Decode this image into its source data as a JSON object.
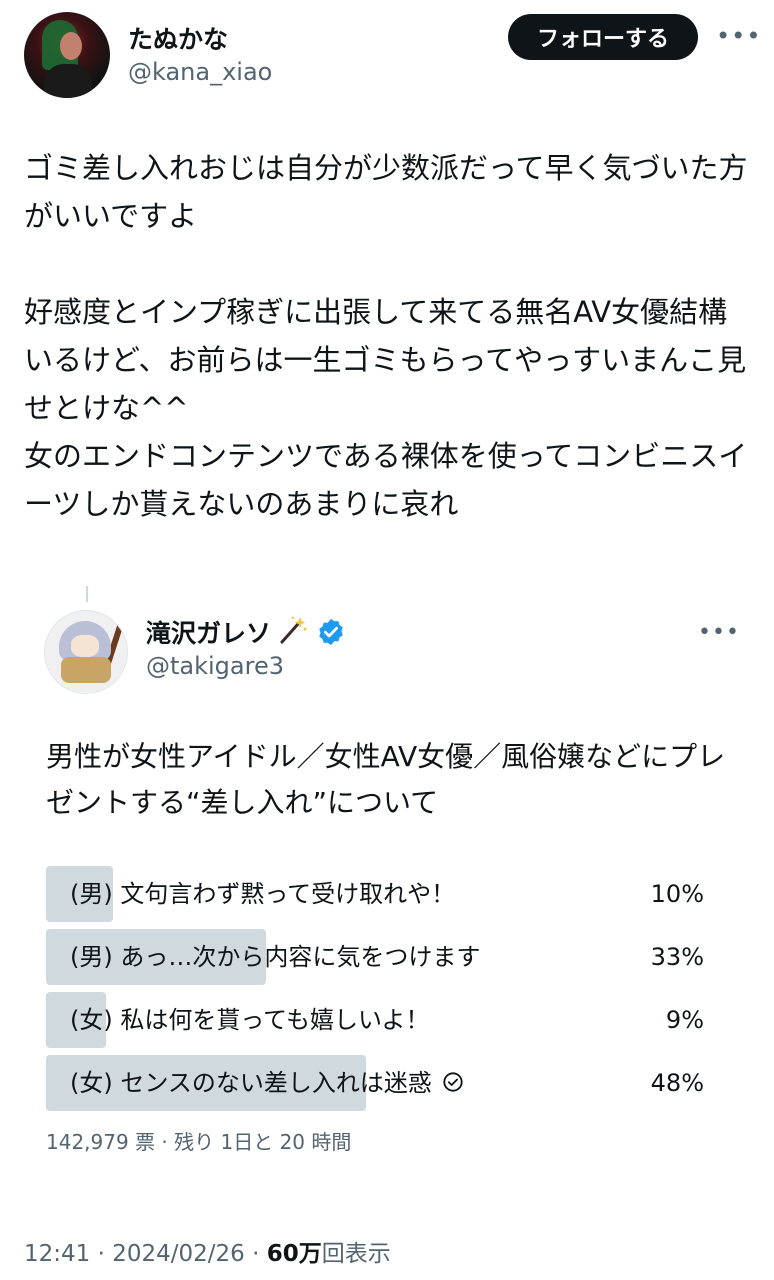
{
  "author": {
    "display_name": "たぬかな",
    "handle": "@kana_xiao"
  },
  "follow_button": "フォローする",
  "more_label": "•••",
  "tweet_text": "ゴミ差し入れおじは自分が少数派だって早く気づいた方がいいですよ\n\n好感度とインプ稼ぎに出張して来てる無名AV女優結構いるけど、お前らは一生ゴミもらってやっすいまんこ見せとけな^^\n女のエンドコンテンツである裸体を使ってコンビニスイーツしか貰えないのあまりに哀れ",
  "quoted": {
    "display_name": "滝沢ガレソ",
    "handle": "@takigare3",
    "verified": true,
    "text": "男性が女性アイドル／女性AV女優／風俗嬢などにプレゼントする“差し入れ”について",
    "poll": {
      "options": [
        {
          "label": "(男) 文句言わず黙って受け取れや！",
          "percent_label": "10%",
          "percent": 10,
          "selected": false
        },
        {
          "label": "(男) あっ…次から内容に気をつけます",
          "percent_label": "33%",
          "percent": 33,
          "selected": false
        },
        {
          "label": "(女) 私は何を貰っても嬉しいよ！",
          "percent_label": "9%",
          "percent": 9,
          "selected": false
        },
        {
          "label": "(女) センスのない差し入れは迷惑",
          "percent_label": "48%",
          "percent": 48,
          "selected": true
        }
      ],
      "meta": "142,979 票 · 残り 1日と 20 時間"
    }
  },
  "footer": {
    "time_date": "12:41 · 2024/02/26 · ",
    "views_count": "60万",
    "views_label": "回表示"
  },
  "colors": {
    "text": "#0f1419",
    "secondary": "#536471",
    "poll_bar": "#cfd9de",
    "verified": "#1d9bf0"
  }
}
